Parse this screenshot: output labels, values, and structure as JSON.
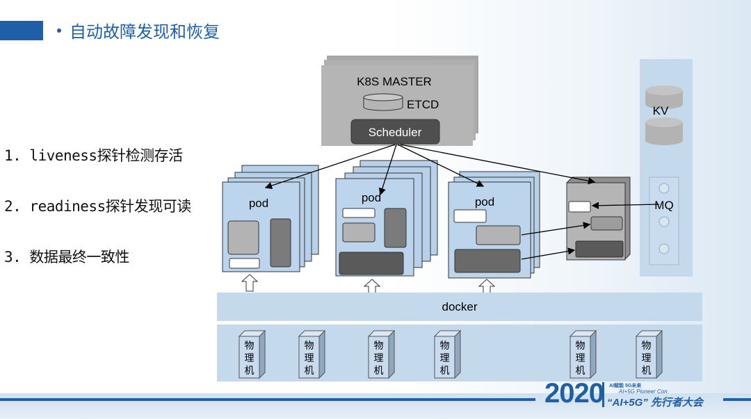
{
  "slide": {
    "title": "自动故障发现和恢复",
    "bullets": [
      "1. liveness探针检测存活",
      "2. readiness探针发现可读",
      "3. 数据最终一致性"
    ]
  },
  "diagram": {
    "master_label": "K8S MASTER",
    "etcd_label": "ETCD",
    "scheduler_label": "Scheduler",
    "kv_label": "KV",
    "mq_label": "MQ",
    "docker_label": "docker",
    "pod_label": "pod",
    "machine_label": "物理机"
  },
  "logo": {
    "year": "2020",
    "line1": "AI赋能 5G未来",
    "line2": "AI+5G Pioneer Con",
    "main": "“AI+5G” 先行者大会"
  },
  "colors": {
    "accent": "#1f5fa8",
    "box_blue": "#b7d1ea",
    "master_gray": "#b3b3b3",
    "dark_gray": "#676767"
  }
}
